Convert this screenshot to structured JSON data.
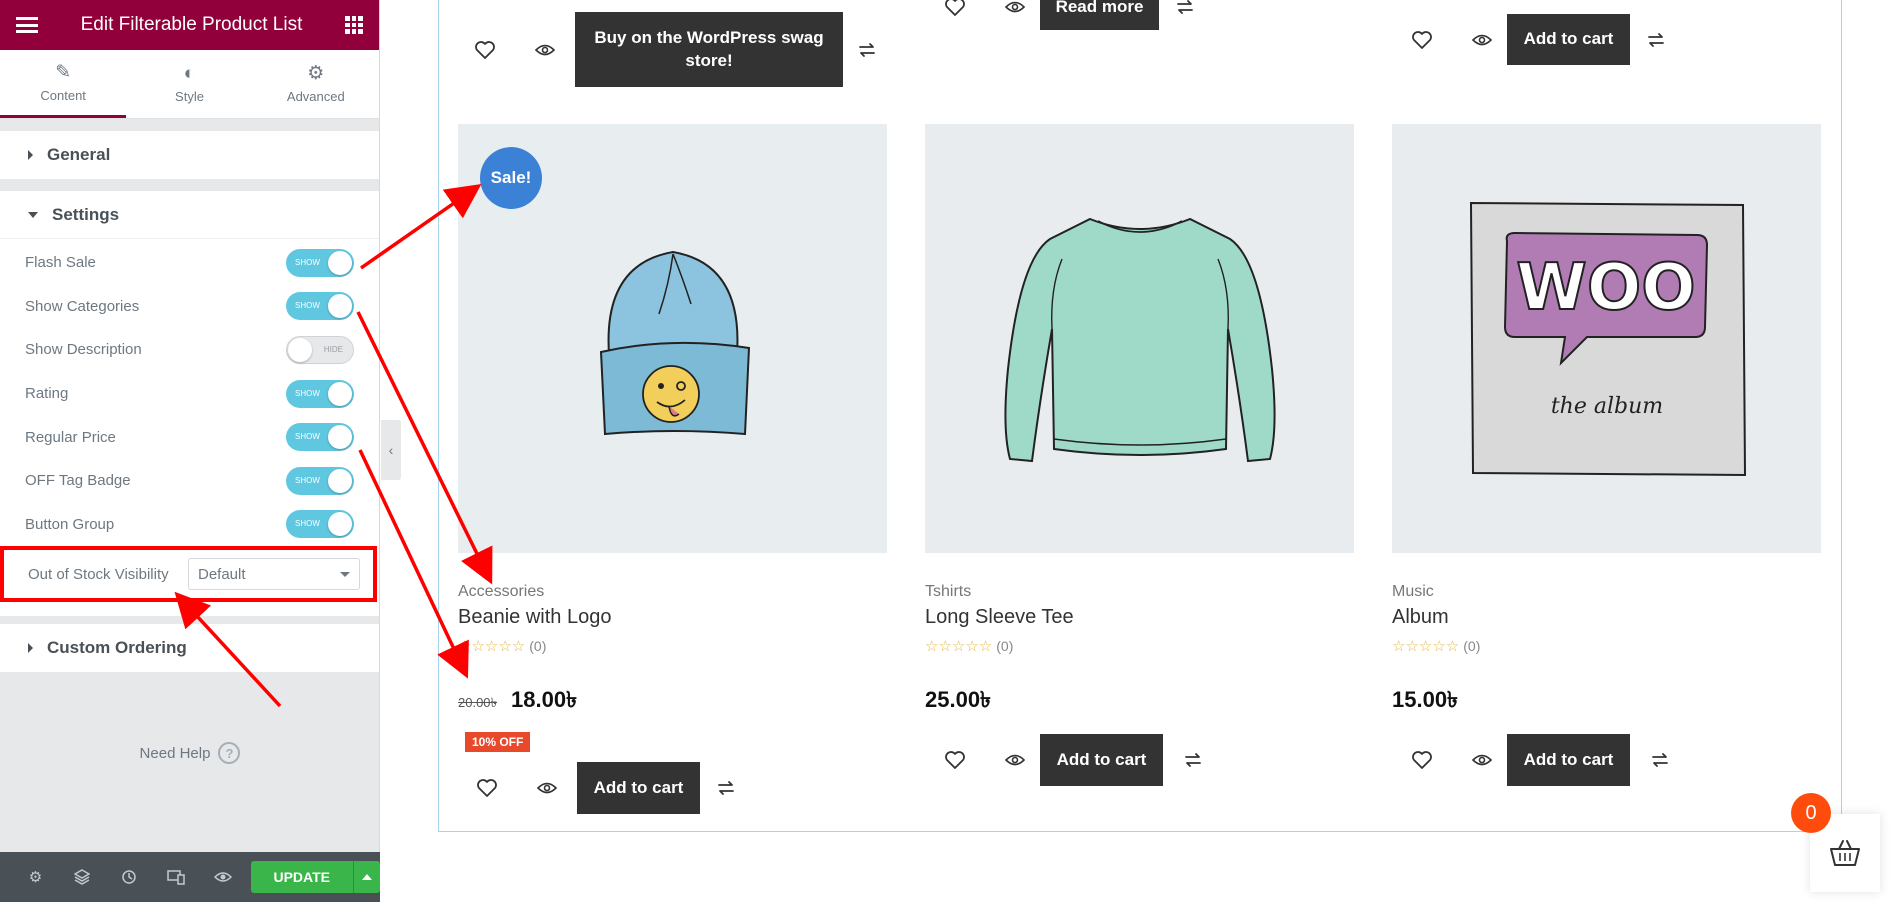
{
  "editor": {
    "title": "Edit Filterable Product List",
    "tabs": [
      {
        "label": "Content",
        "icon": "pencil-icon"
      },
      {
        "label": "Style",
        "icon": "half-circle-icon"
      },
      {
        "label": "Advanced",
        "icon": "gear-icon"
      }
    ],
    "sections": {
      "general": "General",
      "settings": "Settings",
      "custom_ordering": "Custom Ordering"
    },
    "controls": [
      {
        "label": "Flash Sale",
        "state": "SHOW",
        "on": true
      },
      {
        "label": "Show Categories",
        "state": "SHOW",
        "on": true
      },
      {
        "label": "Show Description",
        "state": "HIDE",
        "on": false
      },
      {
        "label": "Rating",
        "state": "SHOW",
        "on": true
      },
      {
        "label": "Regular Price",
        "state": "SHOW",
        "on": true
      },
      {
        "label": "OFF Tag Badge",
        "state": "SHOW",
        "on": true
      },
      {
        "label": "Button Group",
        "state": "SHOW",
        "on": true
      }
    ],
    "out_of_stock": {
      "label": "Out of Stock Visibility",
      "value": "Default"
    },
    "need_help": "Need Help",
    "update": "UPDATE",
    "colors": {
      "header": "#92003b",
      "update": "#39b54a",
      "toggle_on": "#5fc7e0",
      "annotation": "#ff0000"
    }
  },
  "preview": {
    "top_row": [
      {
        "button": "Buy on the WordPress swag store!"
      },
      {
        "button": "Read more"
      },
      {
        "button": "Add to cart"
      }
    ],
    "products": [
      {
        "category": "Accessories",
        "name": "Beanie with Logo",
        "rating_count": "(0)",
        "old_price": "20.00৳",
        "price": "18.00৳",
        "off_badge": "10% OFF",
        "sale_badge": "Sale!",
        "button": "Add to cart",
        "image_icon": "beanie-image"
      },
      {
        "category": "Tshirts",
        "name": "Long Sleeve Tee",
        "rating_count": "(0)",
        "price": "25.00৳",
        "button": "Add to cart",
        "image_icon": "long-sleeve-tee-image"
      },
      {
        "category": "Music",
        "name": "Album",
        "rating_count": "(0)",
        "price": "15.00৳",
        "button": "Add to cart",
        "image_icon": "woo-album-image",
        "album_word": "WOO",
        "album_caption": "the album"
      }
    ],
    "stars": "☆☆☆☆☆",
    "cart_count": "0"
  }
}
